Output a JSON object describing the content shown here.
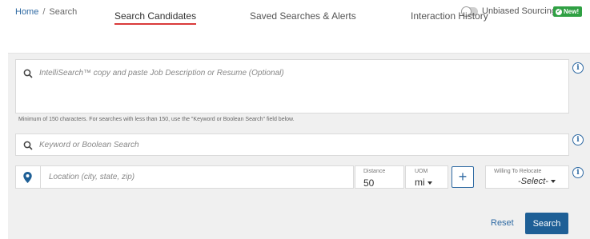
{
  "breadcrumb": {
    "home": "Home",
    "separator": "/",
    "current": "Search"
  },
  "unbiased_sourcing": {
    "label": "Unbiased Sourcing",
    "badge": "New!",
    "enabled": false,
    "badge_color": "#2fa043"
  },
  "tabs": [
    {
      "label": "Search Candidates",
      "active": true
    },
    {
      "label": "Saved Searches & Alerts",
      "active": false
    },
    {
      "label": "Interaction History",
      "active": false
    }
  ],
  "intellisearch": {
    "placeholder": "IntelliSearch™ copy and paste Job Description or Resume (Optional)",
    "value": ""
  },
  "hint": "Minimum of 150 characters. For searches with less than 150, use the \"Keyword or Boolean Search\" field below.",
  "keyword": {
    "placeholder": "Keyword or Boolean Search",
    "value": ""
  },
  "location": {
    "placeholder": "Location (city, state, zip)",
    "value": ""
  },
  "distance": {
    "label": "Distance",
    "value": "50"
  },
  "uom": {
    "label": "UOM",
    "value": "mi"
  },
  "add_button": "+",
  "relocate": {
    "label": "Willing To Relocate",
    "value": "-Select-"
  },
  "actions": {
    "reset": "Reset",
    "search": "Search"
  },
  "colors": {
    "accent": "#2f6aa3",
    "active_tab_underline": "#d93a3a",
    "primary_button": "#1e5f96",
    "panel_bg": "#f0f0f0"
  },
  "icons": {
    "search": "search-icon",
    "info": "info-icon",
    "location": "map-pin-icon",
    "new": "check-circle-icon"
  }
}
